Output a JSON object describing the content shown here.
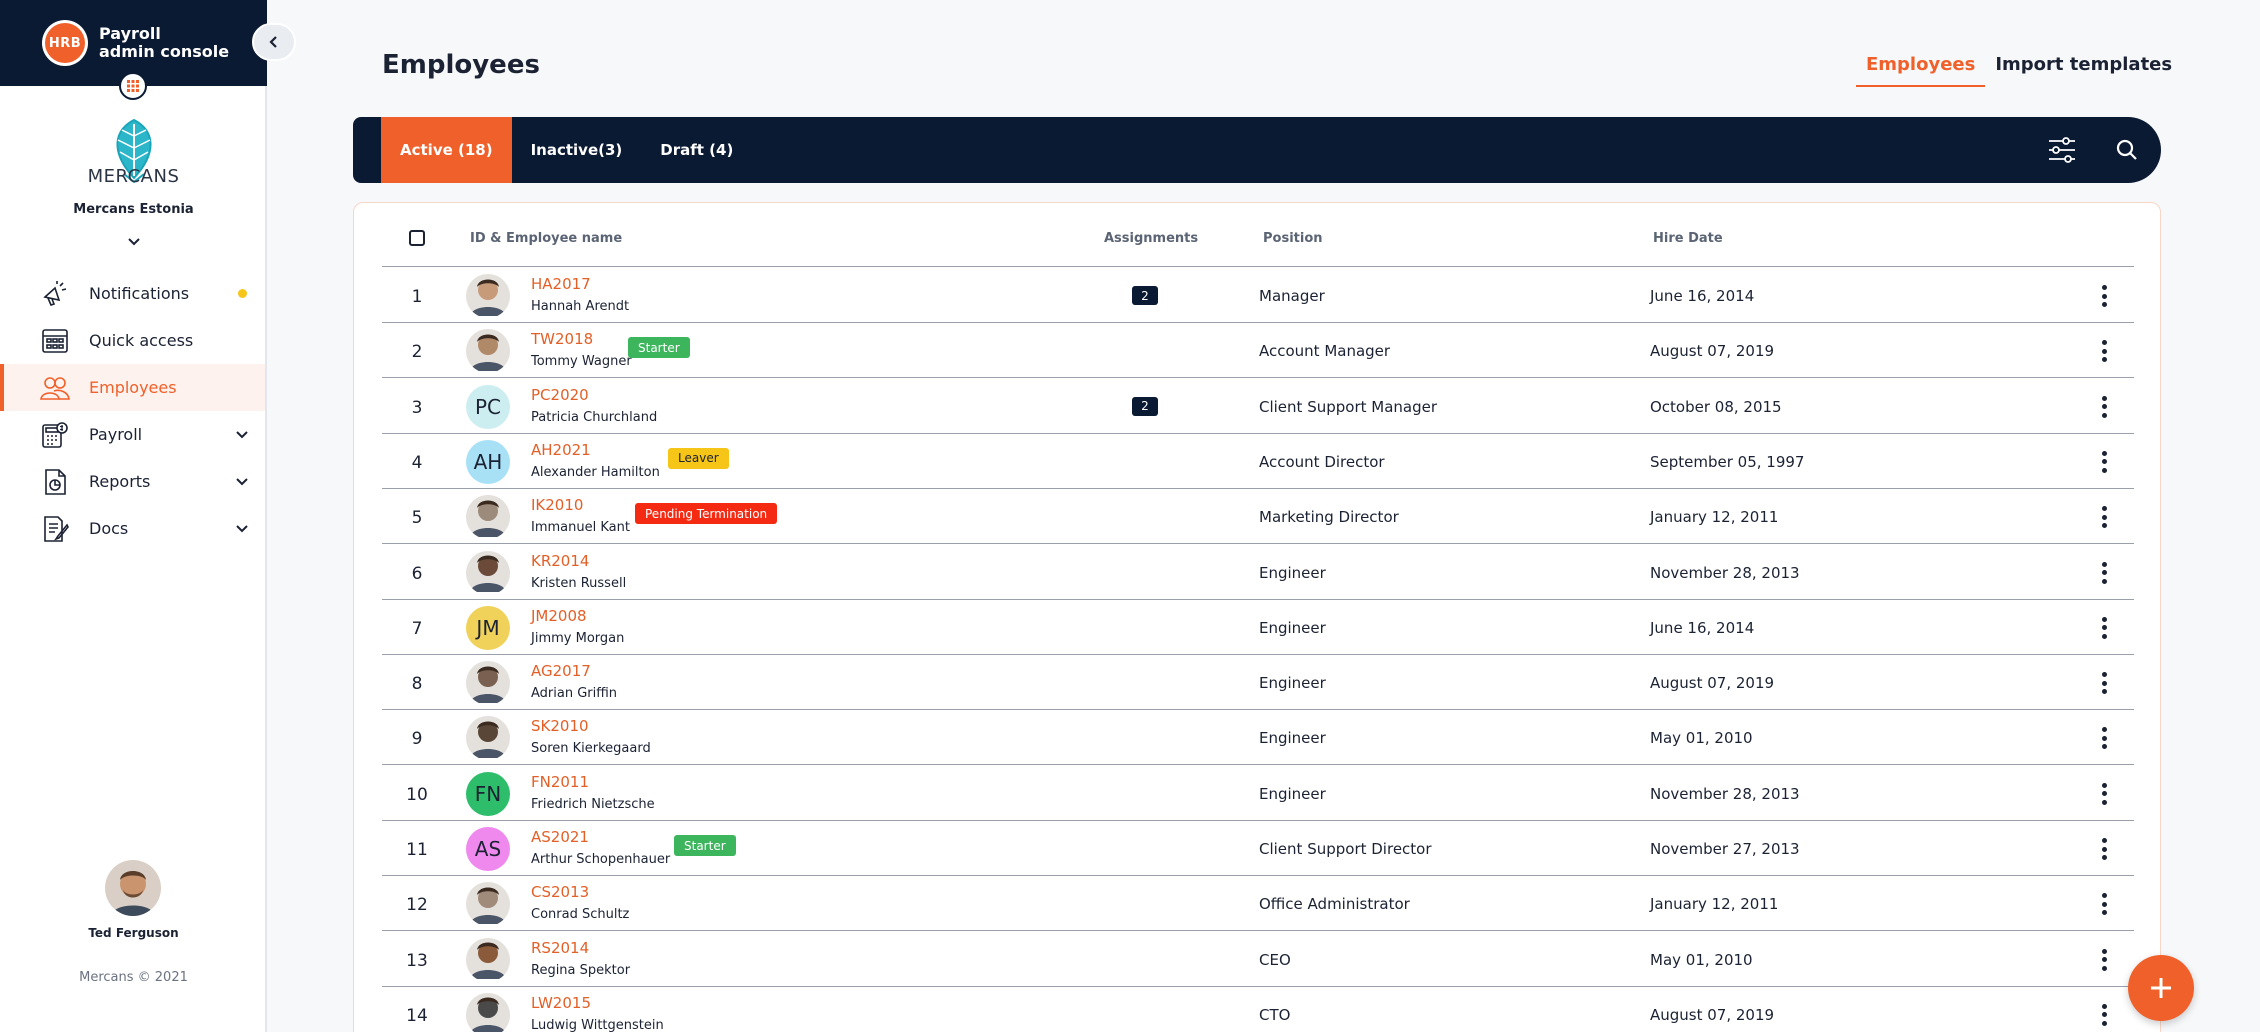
{
  "app": {
    "logo_text": "HRB",
    "console_title_line1": "Payroll",
    "console_title_line2": "admin console"
  },
  "company": {
    "logo_text": "MERCANS",
    "name": "Mercans Estonia"
  },
  "sidebar": {
    "items": [
      {
        "label": "Notifications",
        "icon": "megaphone-icon",
        "active": false,
        "dot": true,
        "expandable": false
      },
      {
        "label": "Quick access",
        "icon": "grid-calendar-icon",
        "active": false,
        "dot": false,
        "expandable": false
      },
      {
        "label": "Employees",
        "icon": "people-icon",
        "active": true,
        "dot": false,
        "expandable": false
      },
      {
        "label": "Payroll",
        "icon": "payroll-calculator-icon",
        "active": false,
        "dot": false,
        "expandable": true
      },
      {
        "label": "Reports",
        "icon": "report-chart-icon",
        "active": false,
        "dot": false,
        "expandable": true
      },
      {
        "label": "Docs",
        "icon": "document-edit-icon",
        "active": false,
        "dot": false,
        "expandable": true
      }
    ]
  },
  "user": {
    "name": "Ted Ferguson"
  },
  "footer": {
    "copyright": "Mercans © 2021"
  },
  "page": {
    "title": "Employees"
  },
  "top_tabs": [
    {
      "label": "Employees",
      "active": true
    },
    {
      "label": "Import templates",
      "active": false
    }
  ],
  "status_tabs": [
    {
      "label": "Active (18)",
      "active": true
    },
    {
      "label": "Inactive(3)",
      "active": false
    },
    {
      "label": "Draft (4)",
      "active": false
    }
  ],
  "table": {
    "headers": {
      "name": "ID & Employee name",
      "assignments": "Assignments",
      "position": "Position",
      "hire_date": "Hire Date"
    },
    "rows": [
      {
        "num": "1",
        "id": "HA2017",
        "name": "Hannah Arendt",
        "avatar": "photo",
        "initials": "",
        "avatar_color": "#c79a7a",
        "badge": "",
        "badge_type": "",
        "assignments": "2",
        "position": "Manager",
        "hire_date": "June 16, 2014"
      },
      {
        "num": "2",
        "id": "TW2018",
        "name": "Tommy Wagner",
        "avatar": "photo",
        "initials": "",
        "avatar_color": "#b08968",
        "badge": "Starter",
        "badge_type": "starter",
        "assignments": "",
        "position": "Account Manager",
        "hire_date": "August 07, 2019"
      },
      {
        "num": "3",
        "id": "PC2020",
        "name": "Patricia Churchland",
        "avatar": "initials",
        "initials": "PC",
        "avatar_color": "#cdeef0",
        "badge": "",
        "badge_type": "",
        "assignments": "2",
        "position": "Client Support Manager",
        "hire_date": "October 08, 2015"
      },
      {
        "num": "4",
        "id": "AH2021",
        "name": "Alexander Hamilton",
        "avatar": "initials",
        "initials": "AH",
        "avatar_color": "#a8e0f5",
        "badge": "Leaver",
        "badge_type": "leaver",
        "assignments": "",
        "position": "Account Director",
        "hire_date": "September 05, 1997"
      },
      {
        "num": "5",
        "id": "IK2010",
        "name": "Immanuel Kant",
        "avatar": "photo",
        "initials": "",
        "avatar_color": "#9c8a7a",
        "badge": "Pending Termination",
        "badge_type": "pending",
        "assignments": "",
        "position": "Marketing Director",
        "hire_date": "January 12, 2011"
      },
      {
        "num": "6",
        "id": "KR2014",
        "name": "Kristen Russell",
        "avatar": "photo",
        "initials": "",
        "avatar_color": "#6b4a3a",
        "badge": "",
        "badge_type": "",
        "assignments": "",
        "position": "Engineer",
        "hire_date": "November 28, 2013"
      },
      {
        "num": "7",
        "id": "JM2008",
        "name": "Jimmy Morgan",
        "avatar": "initials",
        "initials": "JM",
        "avatar_color": "#f0d25a",
        "badge": "",
        "badge_type": "",
        "assignments": "",
        "position": "Engineer",
        "hire_date": "June 16, 2014"
      },
      {
        "num": "8",
        "id": "AG2017",
        "name": "Adrian Griffin",
        "avatar": "photo",
        "initials": "",
        "avatar_color": "#7a6050",
        "badge": "",
        "badge_type": "",
        "assignments": "",
        "position": "Engineer",
        "hire_date": "August 07, 2019"
      },
      {
        "num": "9",
        "id": "SK2010",
        "name": "Soren Kierkegaard",
        "avatar": "photo",
        "initials": "",
        "avatar_color": "#5a4636",
        "badge": "",
        "badge_type": "",
        "assignments": "",
        "position": "Engineer",
        "hire_date": "May 01, 2010"
      },
      {
        "num": "10",
        "id": "FN2011",
        "name": "Friedrich Nietzsche",
        "avatar": "initials",
        "initials": "FN",
        "avatar_color": "#2ebd6b",
        "badge": "",
        "badge_type": "",
        "assignments": "",
        "position": "Engineer",
        "hire_date": "November 28, 2013"
      },
      {
        "num": "11",
        "id": "AS2021",
        "name": "Arthur Schopenhauer",
        "avatar": "initials",
        "initials": "AS",
        "avatar_color": "#f089ee",
        "badge": "Starter",
        "badge_type": "starter",
        "assignments": "",
        "position": "Client Support Director",
        "hire_date": "November 27, 2013"
      },
      {
        "num": "12",
        "id": "CS2013",
        "name": "Conrad Schultz",
        "avatar": "photo",
        "initials": "",
        "avatar_color": "#a08a7a",
        "badge": "",
        "badge_type": "",
        "assignments": "",
        "position": "Office Administrator",
        "hire_date": "January 12, 2011"
      },
      {
        "num": "13",
        "id": "RS2014",
        "name": "Regina Spektor",
        "avatar": "photo",
        "initials": "",
        "avatar_color": "#8a5a3a",
        "badge": "",
        "badge_type": "",
        "assignments": "",
        "position": "CEO",
        "hire_date": "May 01, 2010"
      },
      {
        "num": "14",
        "id": "LW2015",
        "name": "Ludwig Wittgenstein",
        "avatar": "photo",
        "initials": "",
        "avatar_color": "#4a4a4a",
        "badge": "",
        "badge_type": "",
        "assignments": "",
        "position": "CTO",
        "hire_date": "August 07, 2019"
      }
    ]
  },
  "colors": {
    "brand": "#f0602a",
    "navy": "#0b1a33"
  }
}
